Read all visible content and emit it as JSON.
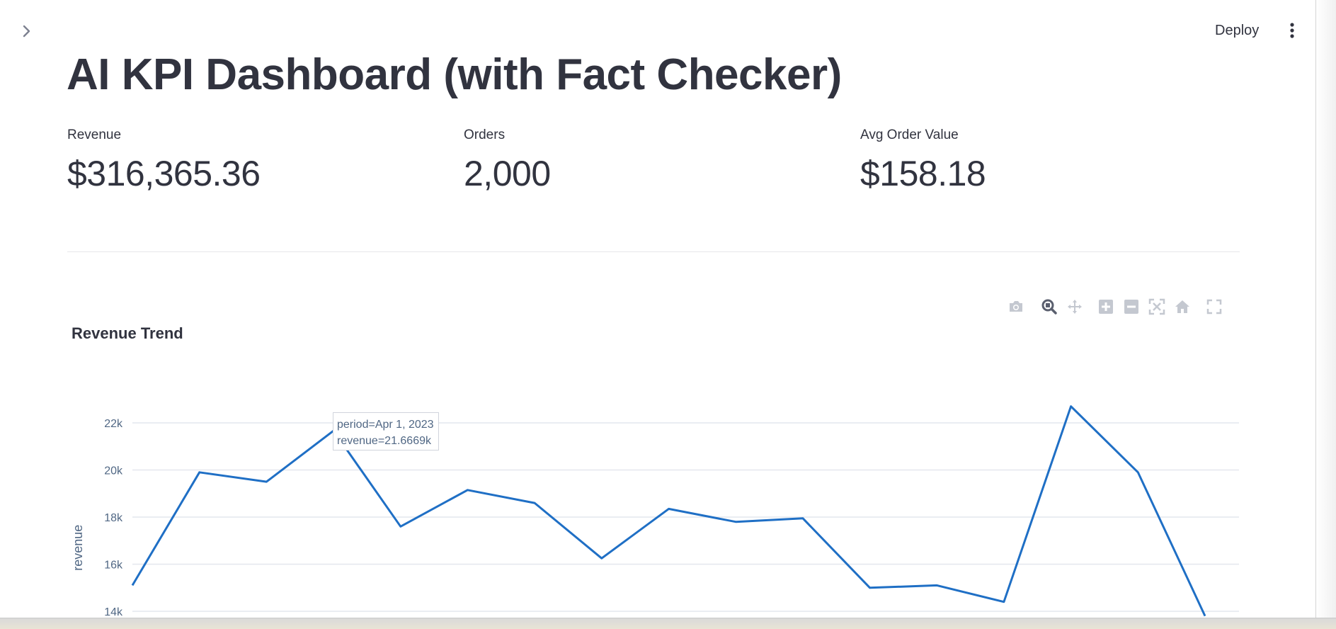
{
  "header": {
    "deploy_label": "Deploy"
  },
  "page": {
    "title": "AI KPI Dashboard (with Fact Checker)"
  },
  "metrics": [
    {
      "label": "Revenue",
      "value": "$316,365.36"
    },
    {
      "label": "Orders",
      "value": "2,000"
    },
    {
      "label": "Avg Order Value",
      "value": "$158.18"
    }
  ],
  "chart": {
    "title": "Revenue Trend",
    "ylabel": "revenue",
    "tooltip": {
      "line1": "period=Apr 1, 2023",
      "line2": "revenue=21.6669k"
    }
  },
  "chart_data": {
    "type": "line",
    "title": "Revenue Trend",
    "xlabel": "",
    "ylabel": "revenue",
    "y_tick_labels": [
      "14k",
      "16k",
      "18k",
      "20k",
      "22k"
    ],
    "y_ticks": [
      14000,
      16000,
      18000,
      20000,
      22000
    ],
    "ylim": [
      14000,
      22400
    ],
    "grid": true,
    "legend": "none",
    "series": [
      {
        "color": "#1f6fc5",
        "values": [
          15100,
          19900,
          19500,
          21667,
          17600,
          19150,
          18600,
          16250,
          18350,
          17800,
          17950,
          15000,
          15100,
          14400,
          22700,
          19900,
          13800
        ]
      }
    ]
  },
  "icons": {
    "sidebar_toggle": "chevron-right-icon",
    "menu": "vertical-dots-icon",
    "modebar": [
      "camera-icon",
      "zoom-icon",
      "pan-icon",
      "zoom-in-icon",
      "zoom-out-icon",
      "autoscale-icon",
      "home-icon",
      "fullscreen-icon"
    ]
  }
}
